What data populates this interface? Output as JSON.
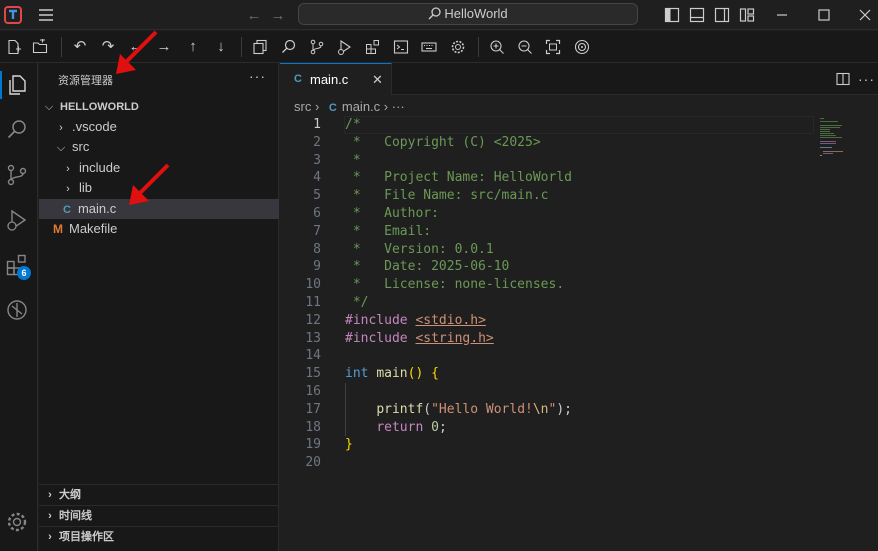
{
  "titlebar": {
    "search_text": "HelloWorld"
  },
  "sidebar": {
    "title": "资源管理器",
    "more": "···",
    "project": "HELLOWORLD",
    "tree": [
      {
        "label": ".vscode",
        "kind": "folder",
        "expanded": false
      },
      {
        "label": "src",
        "kind": "folder",
        "expanded": true
      },
      {
        "label": "include",
        "kind": "folder",
        "expanded": false
      },
      {
        "label": "lib",
        "kind": "folder",
        "expanded": false
      },
      {
        "label": "main.c",
        "kind": "c-file",
        "selected": true
      },
      {
        "label": "Makefile",
        "kind": "makefile"
      }
    ],
    "panels": [
      "大纲",
      "时间线",
      "项目操作区"
    ]
  },
  "activity": {
    "extensions_badge": "6"
  },
  "editor": {
    "tab_label": "main.c",
    "tab_icon": "C",
    "breadcrumb": {
      "folder": "src",
      "file": "main.c",
      "more": "···"
    },
    "current_line": 1,
    "line_numbers": [
      "1",
      "2",
      "3",
      "4",
      "5",
      "6",
      "7",
      "8",
      "9",
      "10",
      "11",
      "12",
      "13",
      "14",
      "15",
      "16",
      "17",
      "18",
      "19",
      "20"
    ]
  },
  "icons": {
    "c_file": "C",
    "makefile": "M"
  },
  "colors": {
    "accent": "#0078d4",
    "annotation_arrow": "#e01010",
    "comment": "#6a9955",
    "keyword": "#569cd6",
    "string": "#ce9178"
  }
}
